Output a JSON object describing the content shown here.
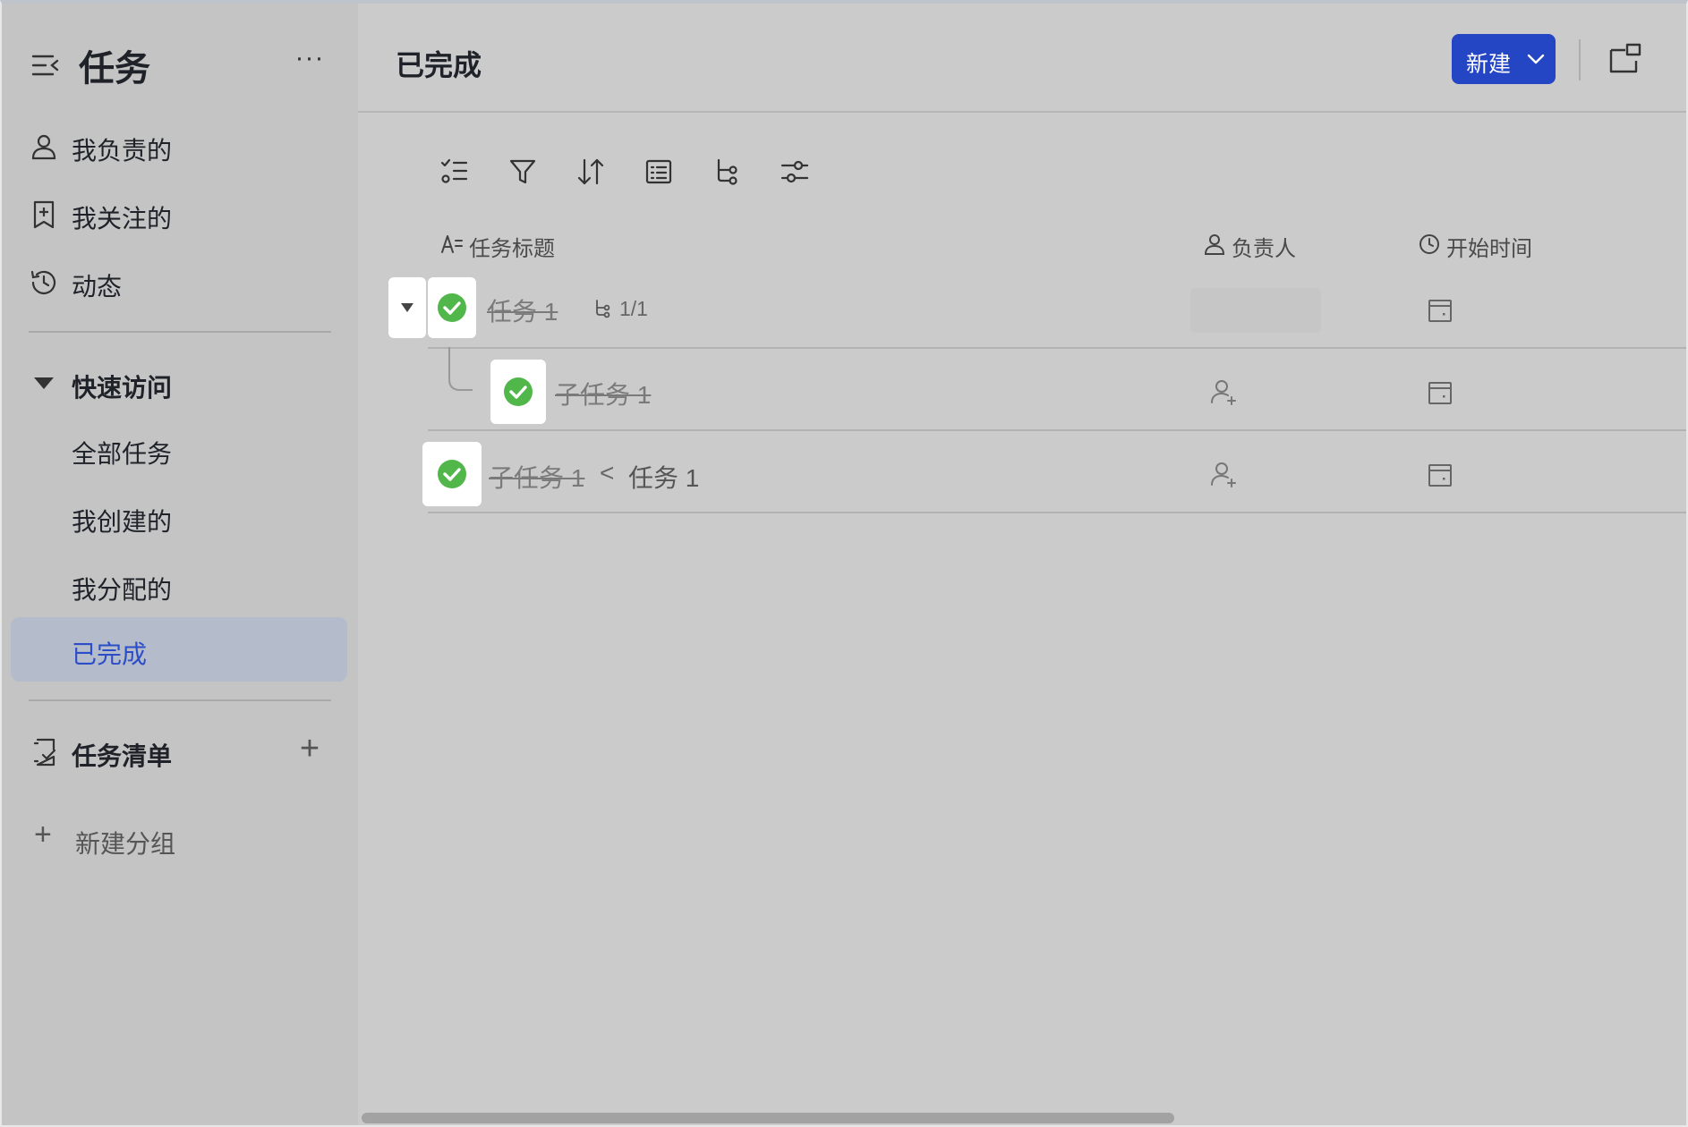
{
  "sidebar": {
    "title": "任务",
    "more": "···",
    "nav": [
      {
        "label": "我负责的",
        "icon": "person-icon"
      },
      {
        "label": "我关注的",
        "icon": "bookmark-star-icon"
      },
      {
        "label": "动态",
        "icon": "history-icon"
      }
    ],
    "quick_access": {
      "label": "快速访问",
      "items": [
        {
          "label": "全部任务"
        },
        {
          "label": "我创建的"
        },
        {
          "label": "我分配的"
        },
        {
          "label": "已完成",
          "active": true
        }
      ]
    },
    "tasklist": {
      "label": "任务清单",
      "add": "+"
    },
    "new_group": {
      "plus": "+",
      "label": "新建分组"
    }
  },
  "main": {
    "title": "已完成",
    "new_button": "新建",
    "toolbar": [
      "checklist-icon",
      "filter-icon",
      "sort-icon",
      "list-view-icon",
      "subtask-icon",
      "settings-sliders-icon"
    ],
    "columns": {
      "title": "任务标题",
      "assignee": "负责人",
      "start_time": "开始时间"
    },
    "rows": [
      {
        "title": "任务 1",
        "done": true,
        "subtask_count": "1/1",
        "expanded": true
      },
      {
        "title": "子任务 1",
        "done": true,
        "indent": true
      },
      {
        "title": "子任务 1",
        "done": true,
        "parent_sep": "<",
        "parent": "任务 1"
      }
    ]
  },
  "colors": {
    "accent": "#2445c4",
    "check": "#52b74a",
    "active_nav_bg": "#b4bccb",
    "active_nav_text": "#2d4dc8"
  }
}
